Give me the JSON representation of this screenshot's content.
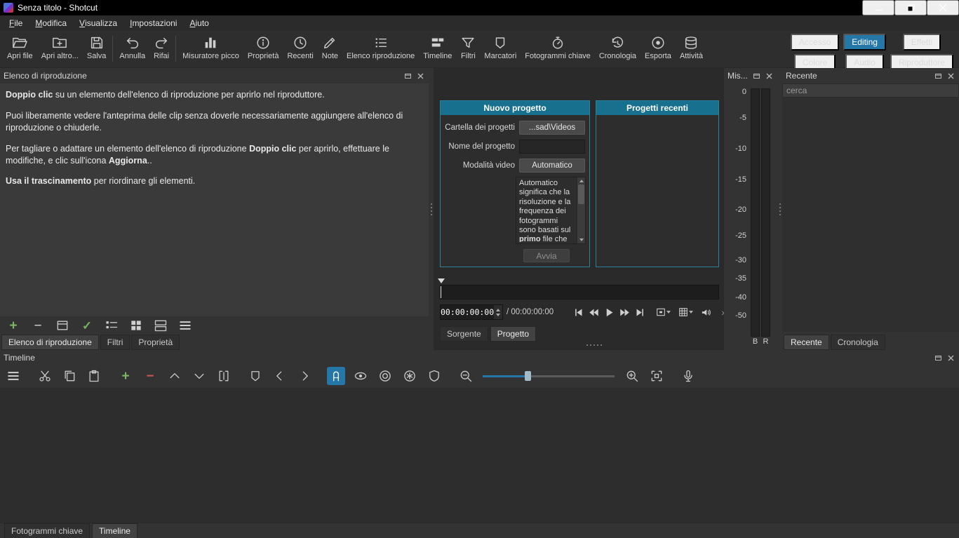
{
  "window": {
    "title": "Senza titolo - Shotcut"
  },
  "menu": {
    "items": [
      {
        "first": "F",
        "rest": "ile"
      },
      {
        "first": "M",
        "rest": "odifica"
      },
      {
        "first": "V",
        "rest": "isualizza"
      },
      {
        "first": "I",
        "rest": "mpostazioni"
      },
      {
        "first": "A",
        "rest": "iuto"
      }
    ]
  },
  "toolbar": {
    "items": [
      {
        "label": "Apri file"
      },
      {
        "label": "Apri altro..."
      },
      {
        "label": "Salva"
      },
      {
        "label": "Annulla"
      },
      {
        "label": "Rifai"
      },
      {
        "label": "Misuratore picco"
      },
      {
        "label": "Proprietà"
      },
      {
        "label": "Recenti"
      },
      {
        "label": "Note"
      },
      {
        "label": "Elenco riproduzione"
      },
      {
        "label": "Timeline"
      },
      {
        "label": "Filtri"
      },
      {
        "label": "Marcatori"
      },
      {
        "label": "Fotogrammi chiave"
      },
      {
        "label": "Cronologia"
      },
      {
        "label": "Esporta"
      },
      {
        "label": "Attività"
      }
    ]
  },
  "layout": {
    "buttons": [
      "Accesso",
      "Editing",
      "Effetti",
      "Colore",
      "Audio",
      "Riproduttore"
    ],
    "active": "Editing"
  },
  "playlist": {
    "title": "Elenco di riproduzione",
    "p1_bold": "Doppio clic",
    "p1_rest": " su un elemento dell'elenco di riproduzione per aprirlo nel riproduttore.",
    "p2": "Puoi liberamente vedere l'anteprima delle clip senza doverle necessariamente aggiungere all'elenco di riproduzione o chiuderle.",
    "p3_a": "Per tagliare o adattare un elemento dell'elenco di riproduzione ",
    "p3_b1": "Doppio clic",
    "p3_c": " per aprirlo, effettuare le modifiche, e clic sull'icona ",
    "p3_b2": "Aggiorna",
    "p3_d": "..",
    "p4_bold": "Usa il trascinamento",
    "p4_rest": " per riordinare gli elementi.",
    "tabs": [
      "Elenco di riproduzione",
      "Filtri",
      "Proprietà"
    ]
  },
  "project": {
    "title": "Nuovo progetto",
    "folder_label": "Cartella dei progetti",
    "folder_button": "...sad\\Videos",
    "name_label": "Nome del progetto",
    "name_value": "",
    "mode_label": "Modalità video",
    "mode_button": "Automatico",
    "desc_a": "Automatico significa che la risoluzione e la frequenza dei fotogrammi sono basati sul ",
    "desc_bold": "primo",
    "desc_b": " file che",
    "start": "Avvia"
  },
  "recent_projects": {
    "title": "Progetti recenti"
  },
  "player": {
    "position": "00:00:00:00",
    "duration_display": "/ 00:00:00:00",
    "tabs": [
      "Sorgente",
      "Progetto"
    ]
  },
  "meter": {
    "title": "Mis...",
    "scale": [
      "0",
      "-5",
      "-10",
      "-15",
      "-20",
      "-25",
      "-30",
      "-35",
      "-40",
      "-50"
    ],
    "ch_left": "B",
    "ch_right": "R"
  },
  "recent": {
    "title": "Recente",
    "search_placeholder": "cerca",
    "tabs": [
      "Recente",
      "Cronologia"
    ]
  },
  "timeline": {
    "title": "Timeline"
  },
  "bottom_tabs": [
    "Fotogrammi chiave",
    "Timeline"
  ],
  "icons": {
    "plus": "+",
    "minus": "−",
    "check": "✓",
    "more": "»"
  }
}
